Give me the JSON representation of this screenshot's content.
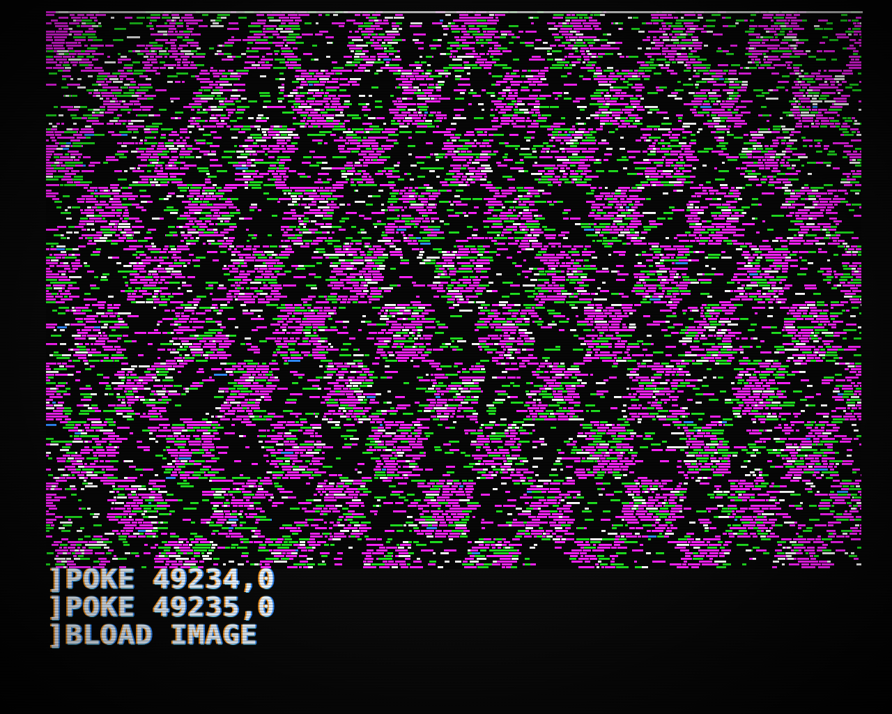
{
  "screen": {
    "mode": "Apple II hi-res graphics with mixed text",
    "background_color": "#070707",
    "graphics": {
      "primary_color": "#ff22ff",
      "secondary_color": "#20e020",
      "highlight_color": "#ffffff",
      "accent_color": "#2f8bff",
      "pattern": "checkered magenta-green dither grid"
    }
  },
  "terminal": {
    "prompt": "]",
    "lines": [
      {
        "command": "POKE 49234,0"
      },
      {
        "command": "POKE 49235,0"
      },
      {
        "command": "BLOAD IMAGE"
      }
    ]
  }
}
